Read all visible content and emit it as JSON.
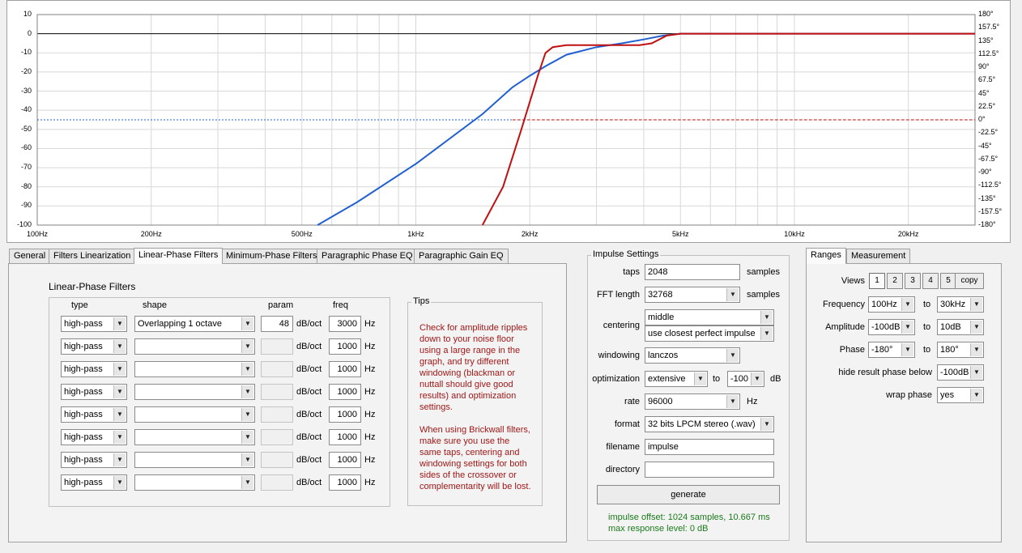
{
  "graph": {
    "y_ticks": [
      "10",
      "0",
      "-10",
      "-20",
      "-30",
      "-40",
      "-50",
      "-60",
      "-70",
      "-80",
      "-90",
      "-100"
    ],
    "phase_ticks": [
      "180°",
      "157.5°",
      "135°",
      "112.5°",
      "90°",
      "67.5°",
      "45°",
      "22.5°",
      "0°",
      "-22.5°",
      "-45°",
      "-67.5°",
      "-90°",
      "-112.5°",
      "-135°",
      "-157.5°",
      "-180°"
    ],
    "x_ticks": [
      "100Hz",
      "200Hz",
      "500Hz",
      "1kHz",
      "2kHz",
      "5kHz",
      "10kHz",
      "20kHz"
    ],
    "colors": {
      "blue": "#2060d0",
      "red": "#c01010",
      "grid": "#d8d8d8",
      "zero": "#000000"
    },
    "chart_data": {
      "type": "line",
      "xscale": "log",
      "xlim": [
        100,
        30000
      ],
      "ylim": [
        -100,
        10
      ],
      "phase_lim": [
        -180,
        180
      ],
      "grid": true,
      "series": [
        {
          "color": "#2060d0",
          "x": [
            550,
            700,
            1000,
            1500,
            1800,
            2000,
            2200,
            2500,
            3000,
            3500,
            4000,
            4500,
            5000,
            7000,
            30000
          ],
          "y": [
            -100,
            -88,
            -68,
            -42,
            -28,
            -22,
            -17,
            -11,
            -7,
            -5,
            -3,
            -1,
            0,
            0,
            0
          ]
        },
        {
          "color": "#c01010",
          "x": [
            1500,
            1700,
            1900,
            2100,
            2200,
            2300,
            2500,
            3000,
            3500,
            3900,
            4200,
            4600,
            5000,
            7000,
            30000
          ],
          "y": [
            -100,
            -80,
            -50,
            -22,
            -10,
            -7,
            -6,
            -6,
            -6,
            -6,
            -5,
            -1,
            0,
            0,
            0
          ]
        },
        {
          "color": "#2060d0",
          "style": "dotted",
          "x": [
            100,
            1800
          ],
          "y": [
            -45,
            -45
          ]
        },
        {
          "color": "#c01010",
          "style": "dashed",
          "x": [
            1800,
            30000
          ],
          "y": [
            -45,
            -45
          ]
        }
      ]
    }
  },
  "tabs": [
    {
      "label": "General"
    },
    {
      "label": "Filters Linearization"
    },
    {
      "label": "Linear-Phase Filters"
    },
    {
      "label": "Minimum-Phase Filters"
    },
    {
      "label": "Paragraphic Phase EQ"
    },
    {
      "label": "Paragraphic Gain EQ"
    }
  ],
  "lpf": {
    "title": "Linear-Phase Filters",
    "headers": {
      "type": "type",
      "shape": "shape",
      "param": "param",
      "freq": "freq"
    },
    "rows": [
      {
        "type": "high-pass",
        "shape": "Overlapping 1 octave",
        "param": "48",
        "unit": "dB/oct",
        "freq": "3000",
        "hz": "Hz"
      },
      {
        "type": "high-pass",
        "shape": "",
        "param": "",
        "unit": "dB/oct",
        "freq": "1000",
        "hz": "Hz"
      },
      {
        "type": "high-pass",
        "shape": "",
        "param": "",
        "unit": "dB/oct",
        "freq": "1000",
        "hz": "Hz"
      },
      {
        "type": "high-pass",
        "shape": "",
        "param": "",
        "unit": "dB/oct",
        "freq": "1000",
        "hz": "Hz"
      },
      {
        "type": "high-pass",
        "shape": "",
        "param": "",
        "unit": "dB/oct",
        "freq": "1000",
        "hz": "Hz"
      },
      {
        "type": "high-pass",
        "shape": "",
        "param": "",
        "unit": "dB/oct",
        "freq": "1000",
        "hz": "Hz"
      },
      {
        "type": "high-pass",
        "shape": "",
        "param": "",
        "unit": "dB/oct",
        "freq": "1000",
        "hz": "Hz"
      },
      {
        "type": "high-pass",
        "shape": "",
        "param": "",
        "unit": "dB/oct",
        "freq": "1000",
        "hz": "Hz"
      }
    ]
  },
  "tips": {
    "title": "Tips",
    "lines1": [
      "Check for amplitude ripples",
      "down to your noise floor",
      "using a large range in the",
      "graph, and try different",
      "windowing (blackman or",
      "nuttall should give good",
      "results) and optimization",
      "settings."
    ],
    "lines2": [
      "When using Brickwall filters,",
      "make sure you use the",
      "same taps, centering and",
      "windowing settings for both",
      "sides of the crossover or",
      "complementarity will be lost."
    ]
  },
  "impulse": {
    "title": "Impulse Settings",
    "taps_label": "taps",
    "taps": "2048",
    "samples1": "samples",
    "fft_label": "FFT length",
    "fft": "32768",
    "samples2": "samples",
    "centering_label": "centering",
    "centering": "middle",
    "centering2": "use closest perfect impulse",
    "windowing_label": "windowing",
    "windowing": "lanczos",
    "opt_label": "optimization",
    "opt": "extensive",
    "to": "to",
    "opt_db": "-100",
    "db": "dB",
    "rate_label": "rate",
    "rate": "96000",
    "hz": "Hz",
    "format_label": "format",
    "format": "32 bits LPCM stereo (.wav)",
    "filename_label": "filename",
    "filename": "impulse",
    "directory_label": "directory",
    "directory": "",
    "generate": "generate",
    "status1": "impulse offset: 1024 samples, 10.667 ms",
    "status2": "max response level: 0 dB"
  },
  "ranges": {
    "tabs": [
      {
        "label": "Ranges"
      },
      {
        "label": "Measurement"
      }
    ],
    "views_label": "Views",
    "views": [
      "1",
      "2",
      "3",
      "4",
      "5"
    ],
    "copy": "copy",
    "frequency_label": "Frequency",
    "freq_from": "100Hz",
    "freq_to": "30kHz",
    "amplitude_label": "Amplitude",
    "amp_from": "-100dB",
    "amp_to": "10dB",
    "phase_label": "Phase",
    "phase_from": "-180°",
    "phase_to": "180°",
    "to": "to",
    "hide_label": "hide result phase below",
    "hide": "-100dB",
    "wrap_label": "wrap phase",
    "wrap": "yes"
  }
}
